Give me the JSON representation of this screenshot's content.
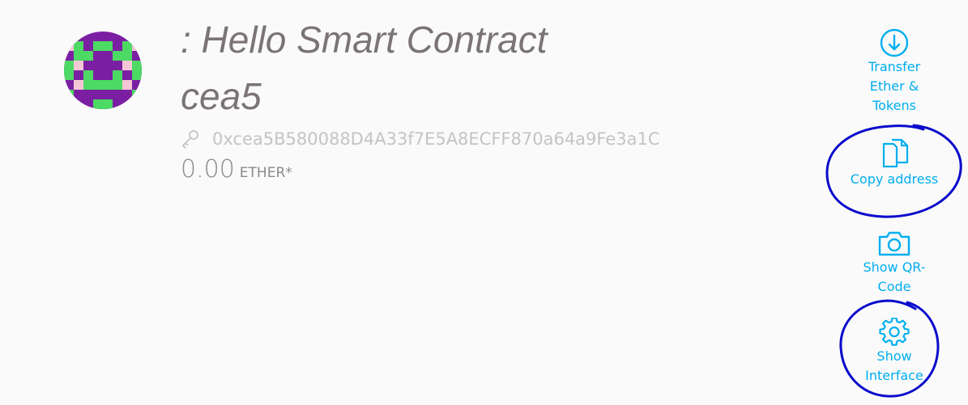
{
  "contract": {
    "title": ": Hello Smart Contract cea5",
    "address": "0xcea5B580088D4A33f7E5A8ECFF870a64a9Fe3a1C",
    "balance": "0.00",
    "unit": "ETHER*"
  },
  "actions": [
    {
      "label": "Transfer Ether & Tokens",
      "icon": "arrow-down-circle-icon"
    },
    {
      "label": "Copy address",
      "icon": "copy-icon"
    },
    {
      "label": "Show QR-Code",
      "icon": "camera-icon"
    },
    {
      "label": "Show Interface",
      "icon": "gear-icon"
    }
  ],
  "colors": {
    "accent": "#00aeef",
    "title": "#7a7474",
    "address": "#c4c4c4",
    "annotation": "#0a0acc"
  }
}
